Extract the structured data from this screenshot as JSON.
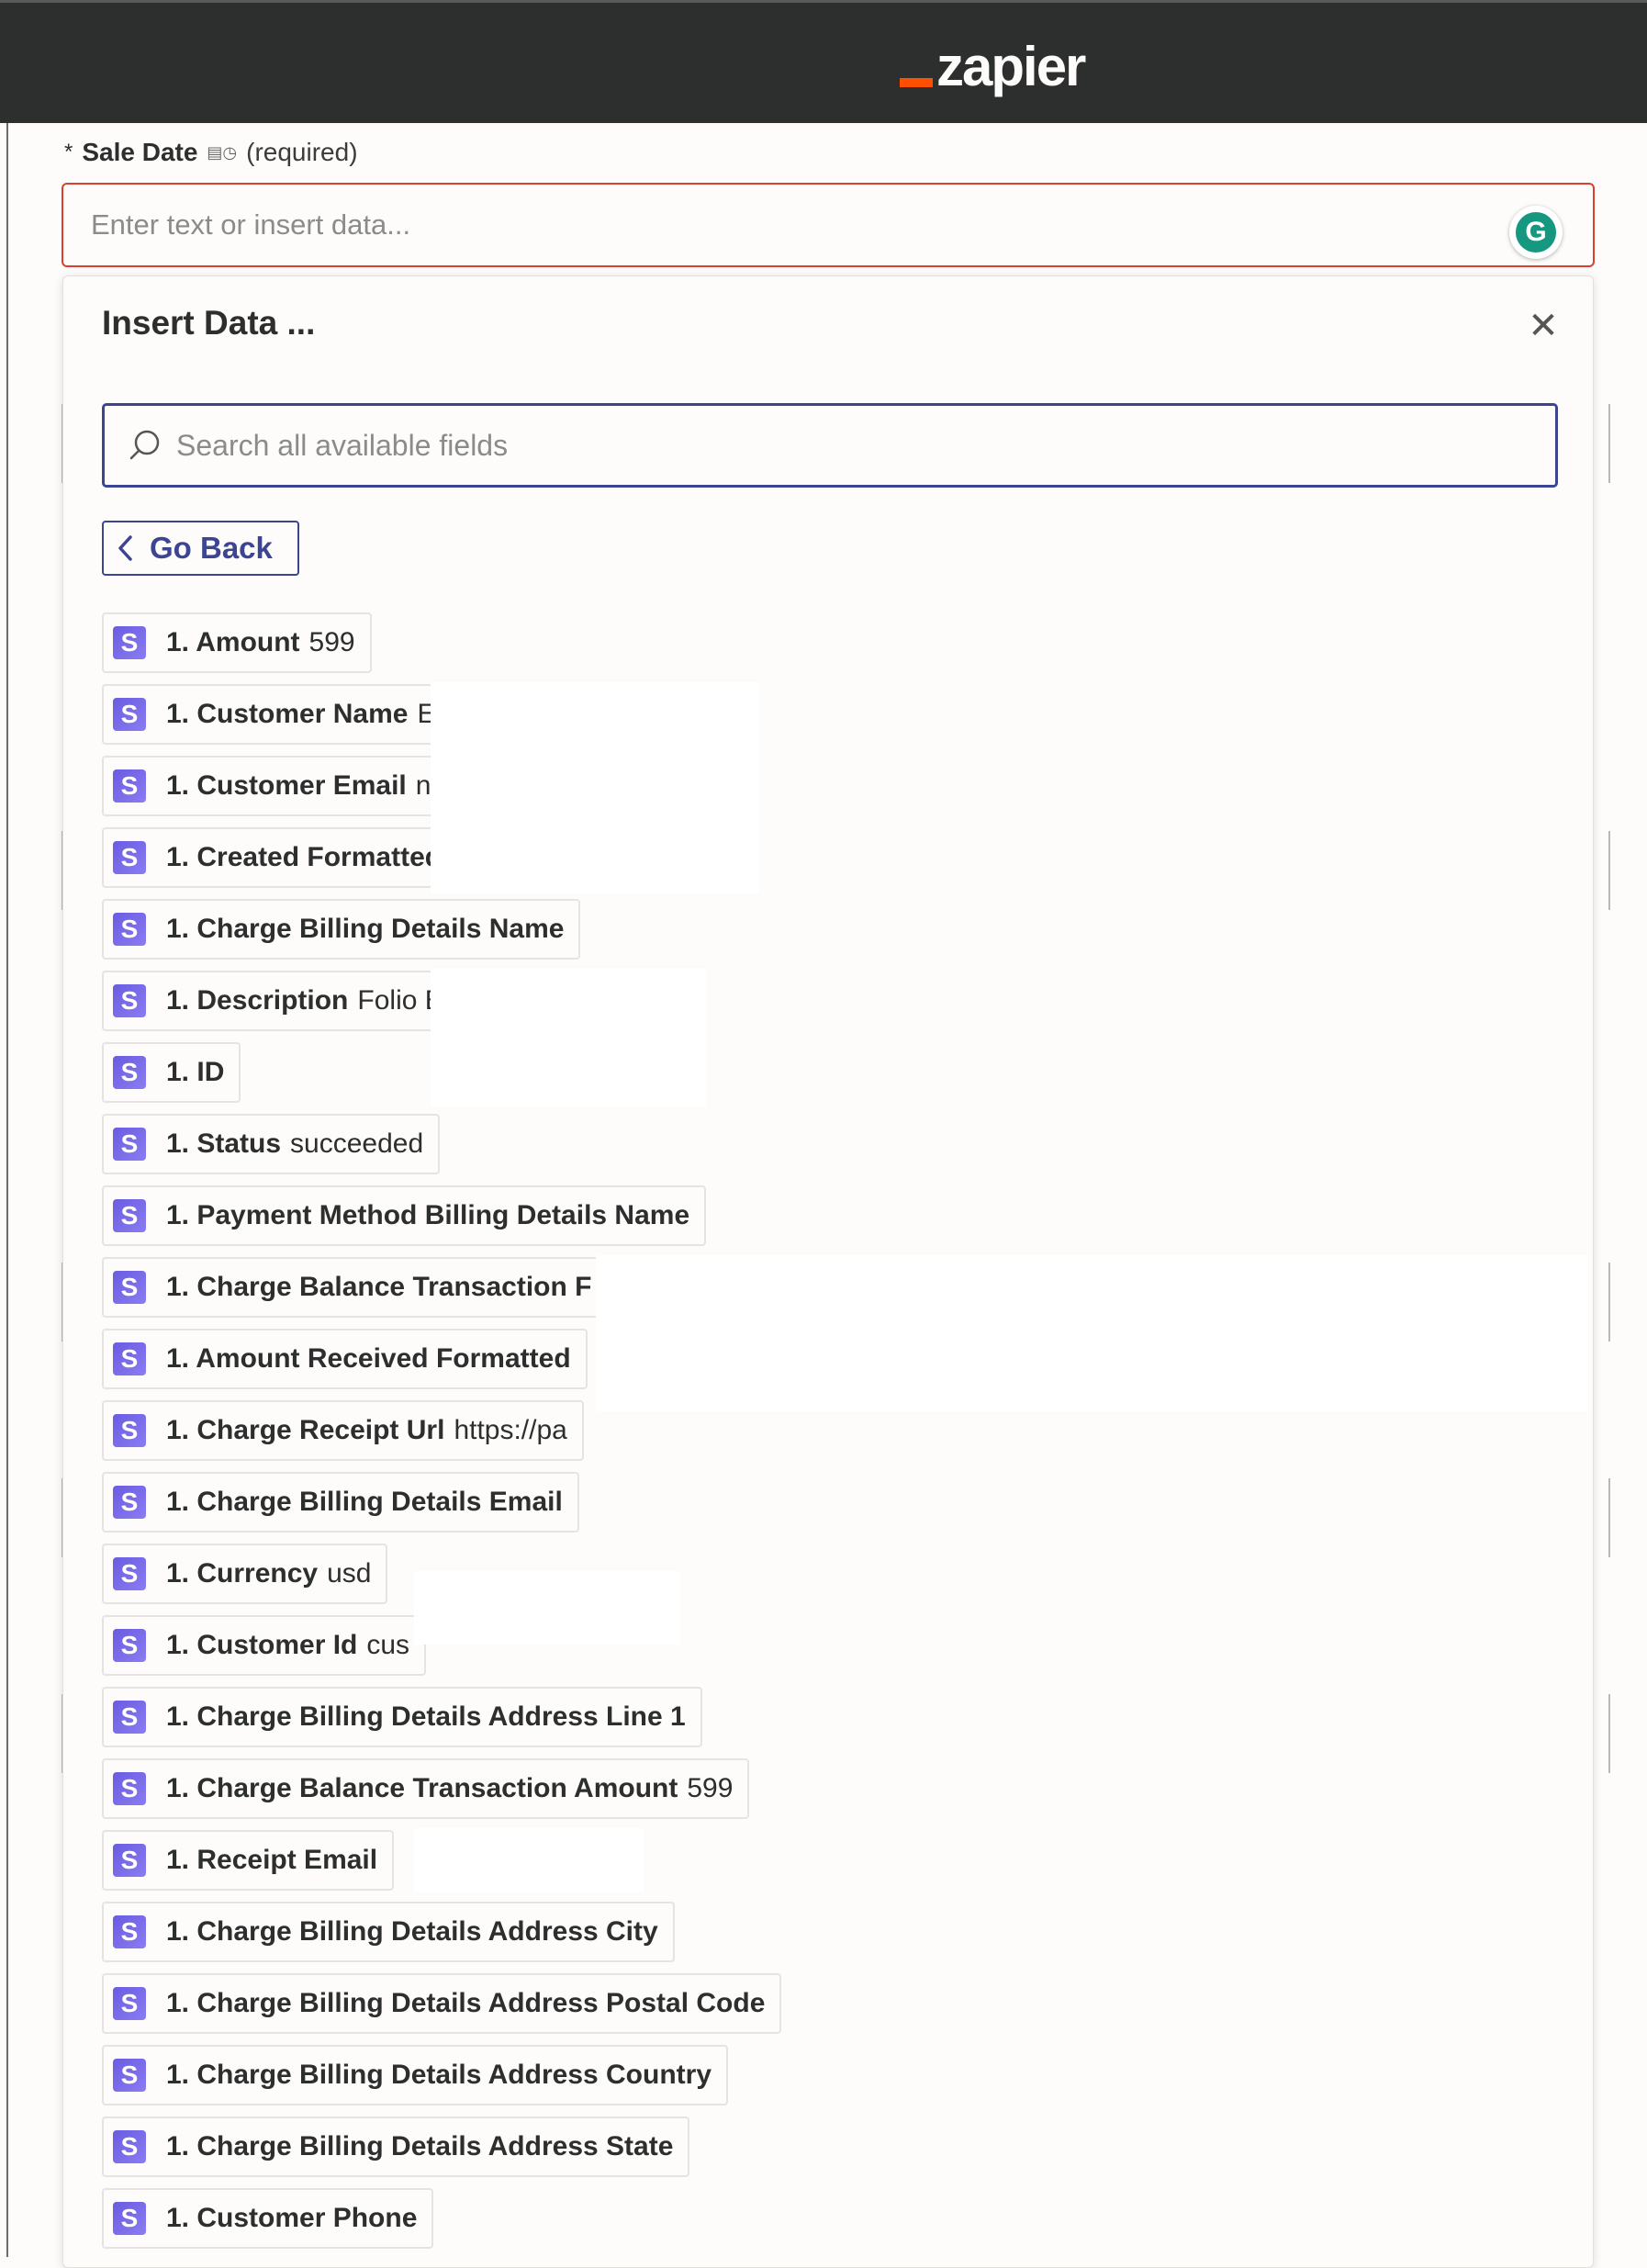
{
  "brand": {
    "logo_text": "zapier",
    "accent": "#ff4f00"
  },
  "field": {
    "required_marker": "*",
    "name": "Sale Date",
    "meta_icons": "▤◷",
    "required_text": "(required)",
    "placeholder": "Enter text or insert data..."
  },
  "grammarly": {
    "letter": "G"
  },
  "panel": {
    "title": "Insert Data ...",
    "close_glyph": "✕",
    "search_placeholder": "Search all available fields",
    "go_back_label": "Go Back"
  },
  "items": [
    {
      "icon": "S",
      "label": "1. Amount",
      "value": "599"
    },
    {
      "icon": "S",
      "label": "1. Customer Name",
      "value": "Ec"
    },
    {
      "icon": "S",
      "label": "1. Customer Email",
      "value": "ne"
    },
    {
      "icon": "S",
      "label": "1. Created Formatted",
      "value": ""
    },
    {
      "icon": "S",
      "label": "1. Charge Billing Details Name",
      "value": ""
    },
    {
      "icon": "S",
      "label": "1. Description",
      "value": "Folio Box"
    },
    {
      "icon": "S",
      "label": "1. ID",
      "value": ""
    },
    {
      "icon": "S",
      "label": "1. Status",
      "value": "succeeded"
    },
    {
      "icon": "S",
      "label": "1. Payment Method Billing Details Name",
      "value": ""
    },
    {
      "icon": "S",
      "label": "1. Charge Balance Transaction F",
      "value": ""
    },
    {
      "icon": "S",
      "label": "1. Amount Received Formatted",
      "value": ""
    },
    {
      "icon": "S",
      "label": "1. Charge Receipt Url",
      "value": "https://pa"
    },
    {
      "icon": "S",
      "label": "1. Charge Billing Details Email",
      "value": ""
    },
    {
      "icon": "S",
      "label": "1. Currency",
      "value": "usd"
    },
    {
      "icon": "S",
      "label": "1. Customer Id",
      "value": "cus"
    },
    {
      "icon": "S",
      "label": "1. Charge Billing Details Address Line 1",
      "value": ""
    },
    {
      "icon": "S",
      "label": "1. Charge Balance Transaction Amount",
      "value": "599"
    },
    {
      "icon": "S",
      "label": "1. Receipt Email",
      "value": ""
    },
    {
      "icon": "S",
      "label": "1. Charge Billing Details Address City",
      "value": ""
    },
    {
      "icon": "S",
      "label": "1. Charge Billing Details Address Postal Code",
      "value": ""
    },
    {
      "icon": "S",
      "label": "1. Charge Billing Details Address Country",
      "value": ""
    },
    {
      "icon": "S",
      "label": "1. Charge Billing Details Address State",
      "value": ""
    },
    {
      "icon": "S",
      "label": "1. Customer Phone",
      "value": ""
    }
  ]
}
